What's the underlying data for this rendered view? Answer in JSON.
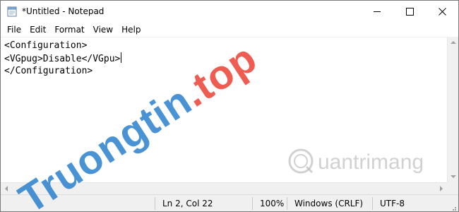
{
  "window": {
    "title": "*Untitled - Notepad"
  },
  "menu": {
    "items": [
      "File",
      "Edit",
      "Format",
      "View",
      "Help"
    ]
  },
  "editor": {
    "lines": [
      "<Configuration>",
      "<VGpug>Disable</VGpu>",
      "</Configuration>"
    ]
  },
  "status": {
    "position": "Ln 2, Col 22",
    "zoom": "100%",
    "line_endings": "Windows (CRLF)",
    "encoding": "UTF-8"
  },
  "watermarks": {
    "primary_a": "Truongtin",
    "primary_b": ".top",
    "secondary": "uantrimang"
  },
  "icons": {
    "app": "notepad-icon",
    "minimize": "minimize-icon",
    "maximize": "maximize-icon",
    "close": "close-icon"
  },
  "colors": {
    "watermark_blue": "#2980ce",
    "watermark_red": "#eb4034",
    "chrome": "#f0f0f0"
  }
}
